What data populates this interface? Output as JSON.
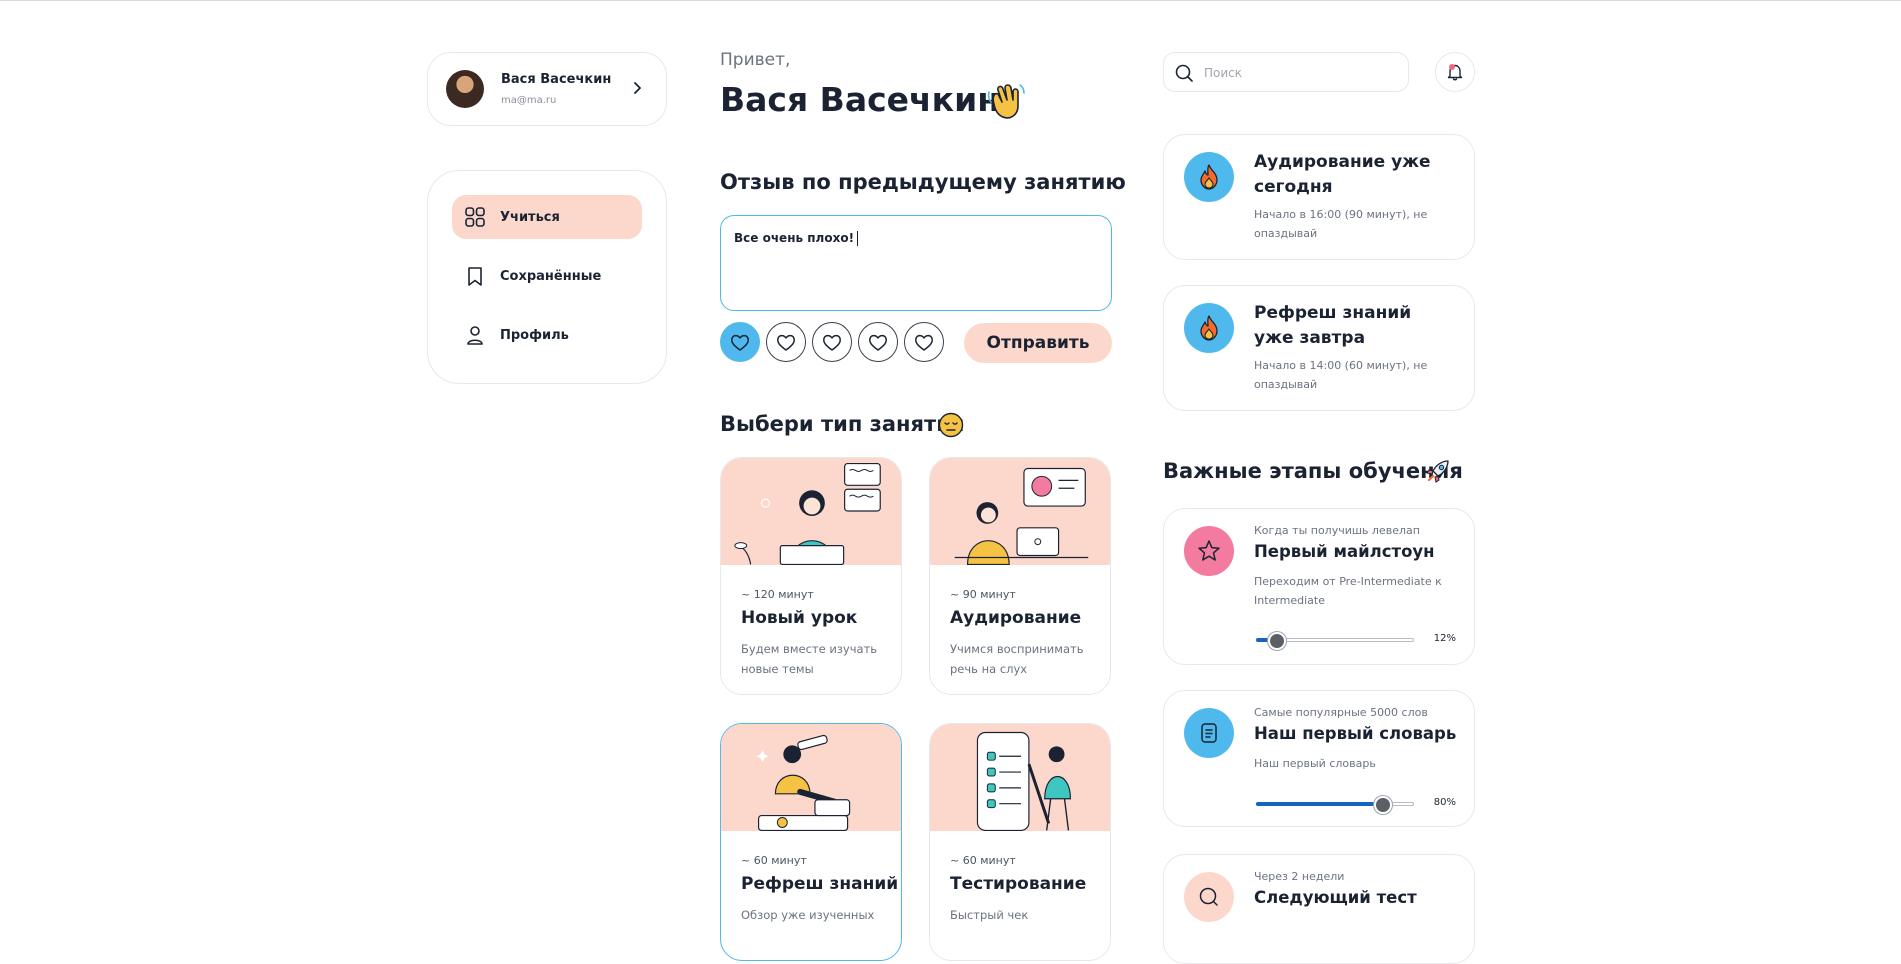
{
  "user": {
    "name": "Вася Васечкин",
    "email": "ma@ma.ru"
  },
  "nav": [
    {
      "label": "Учиться",
      "active": true,
      "icon": "grid-icon"
    },
    {
      "label": "Сохранённые",
      "active": false,
      "icon": "bookmark-icon"
    },
    {
      "label": "Профиль",
      "active": false,
      "icon": "user-icon"
    }
  ],
  "header": {
    "greeting": "Привет,",
    "title": "Вася Васечкин",
    "emoji": "waving-hand-icon"
  },
  "feedback": {
    "title": "Отзыв по предыдущему занятию",
    "value": "Все очень плохо!",
    "rating_selected": 1,
    "rating_max": 5,
    "submit_label": "Отправить"
  },
  "lessons": {
    "title": "Выбери тип занятия",
    "emoji": "pensive-face-icon",
    "items": [
      {
        "duration": "~ 120 минут",
        "name": "Новый урок",
        "desc": "Будем вместе изучать новые темы",
        "selected": false
      },
      {
        "duration": "~ 90 минут",
        "name": "Аудирование",
        "desc": "Учимся воспринимать речь на слух",
        "selected": false
      },
      {
        "duration": "~ 60 минут",
        "name": "Рефреш знаний",
        "desc": "Обзор уже изученных",
        "selected": true
      },
      {
        "duration": "~ 60 минут",
        "name": "Тестирование",
        "desc": "Быстрый чек",
        "selected": false
      }
    ]
  },
  "search": {
    "placeholder": "Поиск",
    "value": ""
  },
  "notifications": {
    "has_unread": true,
    "dot_color": "#f0677f"
  },
  "events": [
    {
      "title": "Аудирование уже сегодня",
      "sub": "Начало в 16:00 (90 минут), не опаздывай",
      "icon": "fire-icon"
    },
    {
      "title": "Рефреш знаний уже завтра",
      "sub": "Начало в 14:00 (60 минут), не опаздывай",
      "icon": "fire-icon"
    }
  ],
  "milestones": {
    "title": "Важные этапы обучения",
    "emoji": "rocket-icon",
    "items": [
      {
        "kicker": "Когда ты получишь левелап",
        "title": "Первый майлстоун",
        "desc": "Переходим от Pre-Intermediate к Intermediate",
        "progress": 12,
        "progress_label": "12%",
        "icon": "star-icon",
        "color": "#f47ba0"
      },
      {
        "kicker": "Самые популярные 5000 слов",
        "title": "Наш первый словарь",
        "desc": "Наш первый словарь",
        "progress": 80,
        "progress_label": "80%",
        "icon": "document-icon",
        "color": "#4fb9ee"
      },
      {
        "kicker": "Через 2 недели",
        "title": "Следующий тест",
        "desc": "",
        "icon": "search-bubble-icon",
        "color": "#fcd8cc"
      }
    ]
  },
  "colors": {
    "accent_blue": "#4fb9ee",
    "accent_peach": "#fcd8cc",
    "text_dark": "#1b2333",
    "progress_blue": "#1565c0"
  }
}
